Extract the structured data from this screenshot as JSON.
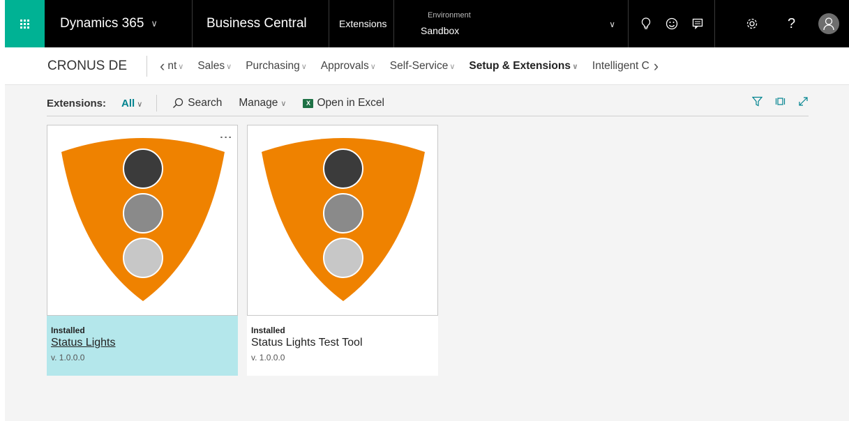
{
  "topbar": {
    "app_name": "Dynamics 365",
    "app_chevron": "∨",
    "product": "Business Central",
    "section": "Extensions",
    "environment_label": "Environment",
    "environment_value": "Sandbox",
    "icons": [
      "lightbulb-icon",
      "smiley-icon",
      "feedback-icon",
      "gear-icon",
      "help-icon",
      "user-avatar-icon"
    ],
    "accent": "#00b294"
  },
  "navbar": {
    "company": "CRONUS DE",
    "items": [
      {
        "label": "nt"
      },
      {
        "label": "Sales"
      },
      {
        "label": "Purchasing"
      },
      {
        "label": "Approvals"
      },
      {
        "label": "Self-Service"
      },
      {
        "label": "Setup & Extensions"
      },
      {
        "label": "Intelligent C"
      }
    ]
  },
  "actionbar": {
    "label": "Extensions:",
    "filter": "All",
    "search": "Search",
    "manage": "Manage",
    "excel_icon_text": "X",
    "open_excel": "Open in Excel",
    "right_icons": [
      "filter-icon",
      "layout-icon",
      "expand-icon"
    ]
  },
  "tiles": [
    {
      "status": "Installed",
      "title": "Status Lights",
      "version": "v. 1.0.0.0",
      "selected": true
    },
    {
      "status": "Installed",
      "title": "Status Lights Test Tool",
      "version": "v. 1.0.0.0",
      "selected": false
    }
  ],
  "colors": {
    "shield": "#ef8200",
    "light_top": "#3b3b3b",
    "light_mid": "#8a8a8a",
    "light_bottom": "#c7c7c7",
    "selected_tile": "#b4e7eb"
  }
}
